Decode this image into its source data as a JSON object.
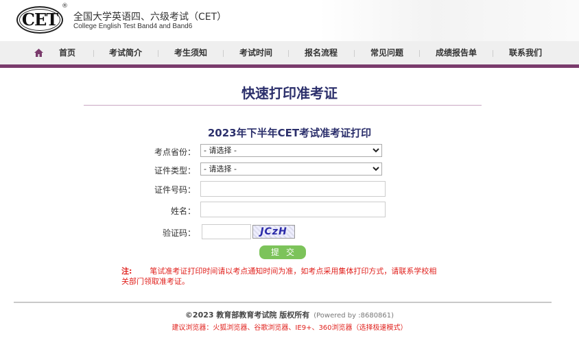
{
  "header": {
    "logo": "CET",
    "registered": "®",
    "title_cn": "全国大学英语四、六级考试（CET）",
    "title_en": "College English Test Band4 and Band6"
  },
  "nav": {
    "items": [
      "首页",
      "考试简介",
      "考生须知",
      "考试时间",
      "报名流程",
      "常见问题",
      "成绩报告单",
      "联系我们"
    ]
  },
  "page": {
    "title": "快速打印准考证",
    "subtitle": "2023年下半年CET考试准考证打印"
  },
  "form": {
    "province_label": "考点省份：",
    "province_value": "- 请选择 -",
    "idtype_label": "证件类型：",
    "idtype_value": "- 请选择 -",
    "idnum_label": "证件号码：",
    "idnum_value": "",
    "name_label": "姓名：",
    "name_value": "",
    "captcha_label": "验证码：",
    "captcha_value": "",
    "captcha_image_text": "JCzH",
    "submit": "提交"
  },
  "note": {
    "prefix": "注:",
    "text": "笔试准考证打印时间请以考点通知时间为准，如考点采用集体打印方式，请联系学校相关部门领取准考证。"
  },
  "footer": {
    "copyright": "©2023  教育部教育考试院  版权所有",
    "powered": "(Powered by :8680861)",
    "browsers": "建议浏览器：火狐浏览器、谷歌浏览器、IE9+、360浏览器（选择极速模式）"
  },
  "colors": {
    "accent": "#7a3b6c",
    "title": "#2b2f6b",
    "submit": "#7cc35a",
    "note": "#e0201c"
  }
}
